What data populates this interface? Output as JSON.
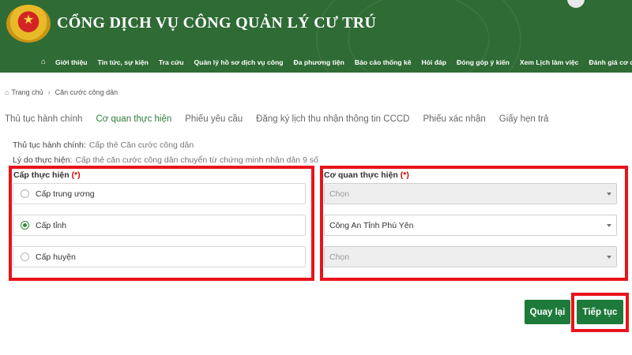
{
  "header": {
    "title": "CỔNG DỊCH VỤ CÔNG QUẢN LÝ CƯ TRÚ",
    "emblem_icon": "police-emblem-icon",
    "colors": {
      "background": "#2f6b35",
      "accent": "#1e7a3a",
      "highlight": "#e8141b"
    },
    "nav": [
      "Giới thiệu",
      "Tin tức, sự kiện",
      "Tra cứu",
      "Quản lý hồ sơ dịch vụ công",
      "Đa phương tiện",
      "Báo cáo thống kê",
      "Hỏi đáp",
      "Đóng góp ý kiến",
      "Xem Lịch làm việc",
      "Đánh giá cơ quan"
    ]
  },
  "breadcrumb": {
    "home": "Trang chủ",
    "current": "Căn cước công dân"
  },
  "tabs": [
    {
      "label": "Thủ tục hành chính",
      "active": false
    },
    {
      "label": "Cơ quan thực hiện",
      "active": true
    },
    {
      "label": "Phiếu yêu cầu",
      "active": false
    },
    {
      "label": "Đăng ký lịch thu nhận thông tin CCCD",
      "active": false
    },
    {
      "label": "Phiếu xác nhận",
      "active": false
    },
    {
      "label": "Giấy hẹn trả",
      "active": false
    }
  ],
  "info": {
    "procedure_label": "Thủ tục hành chính:",
    "procedure_value": "Cấp thẻ Căn cước công dân",
    "reason_label": "Lý do thực hiện:",
    "reason_value": "Cấp thẻ căn cước công dân chuyển từ chứng minh nhân dân 9 số"
  },
  "level": {
    "label": "Cấp thực hiện",
    "required_mark": "(*)",
    "options": [
      {
        "label": "Cấp trung ương",
        "selected": false
      },
      {
        "label": "Cấp tỉnh",
        "selected": true
      },
      {
        "label": "Cấp huyện",
        "selected": false
      }
    ]
  },
  "agency": {
    "label": "Cơ quan thực hiện",
    "required_mark": "(*)",
    "selects": [
      {
        "value": "Chọn",
        "disabled": true
      },
      {
        "value": "Công An Tỉnh Phú Yên",
        "disabled": false
      },
      {
        "value": "Chọn",
        "disabled": true
      }
    ]
  },
  "buttons": {
    "back": "Quay lại",
    "next": "Tiếp tục"
  }
}
